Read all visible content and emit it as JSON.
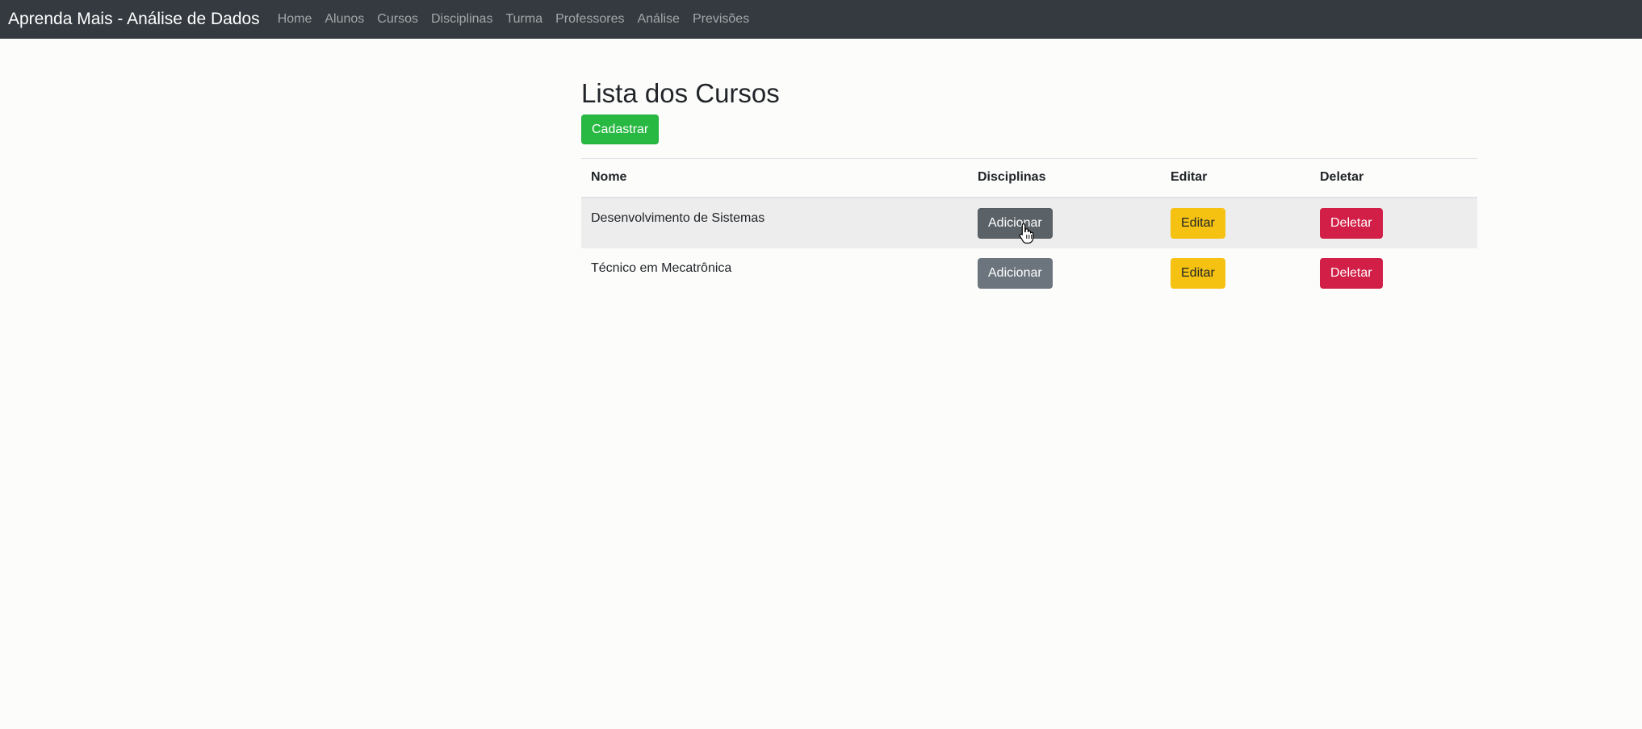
{
  "navbar": {
    "brand": "Aprenda Mais - Análise de Dados",
    "links": [
      "Home",
      "Alunos",
      "Cursos",
      "Disciplinas",
      "Turma",
      "Professores",
      "Análise",
      "Previsões"
    ]
  },
  "main": {
    "title": "Lista dos Cursos",
    "add_button": "Cadastrar",
    "table": {
      "headers": [
        "Nome",
        "Disciplinas",
        "Editar",
        "Deletar"
      ],
      "rows": [
        {
          "name": "Desenvolvimento de Sistemas",
          "add_label": "Adicionar",
          "edit_label": "Editar",
          "delete_label": "Deletar"
        },
        {
          "name": "Técnico em Mecatrônica",
          "add_label": "Adicionar",
          "edit_label": "Editar",
          "delete_label": "Deletar"
        }
      ]
    }
  },
  "colors": {
    "navbar_bg": "#343a40",
    "success": "#28b943",
    "secondary": "#6c757d",
    "warning": "#f5c211",
    "danger": "#d21f47"
  },
  "icons": {
    "cursor": "hand-pointer-icon"
  }
}
